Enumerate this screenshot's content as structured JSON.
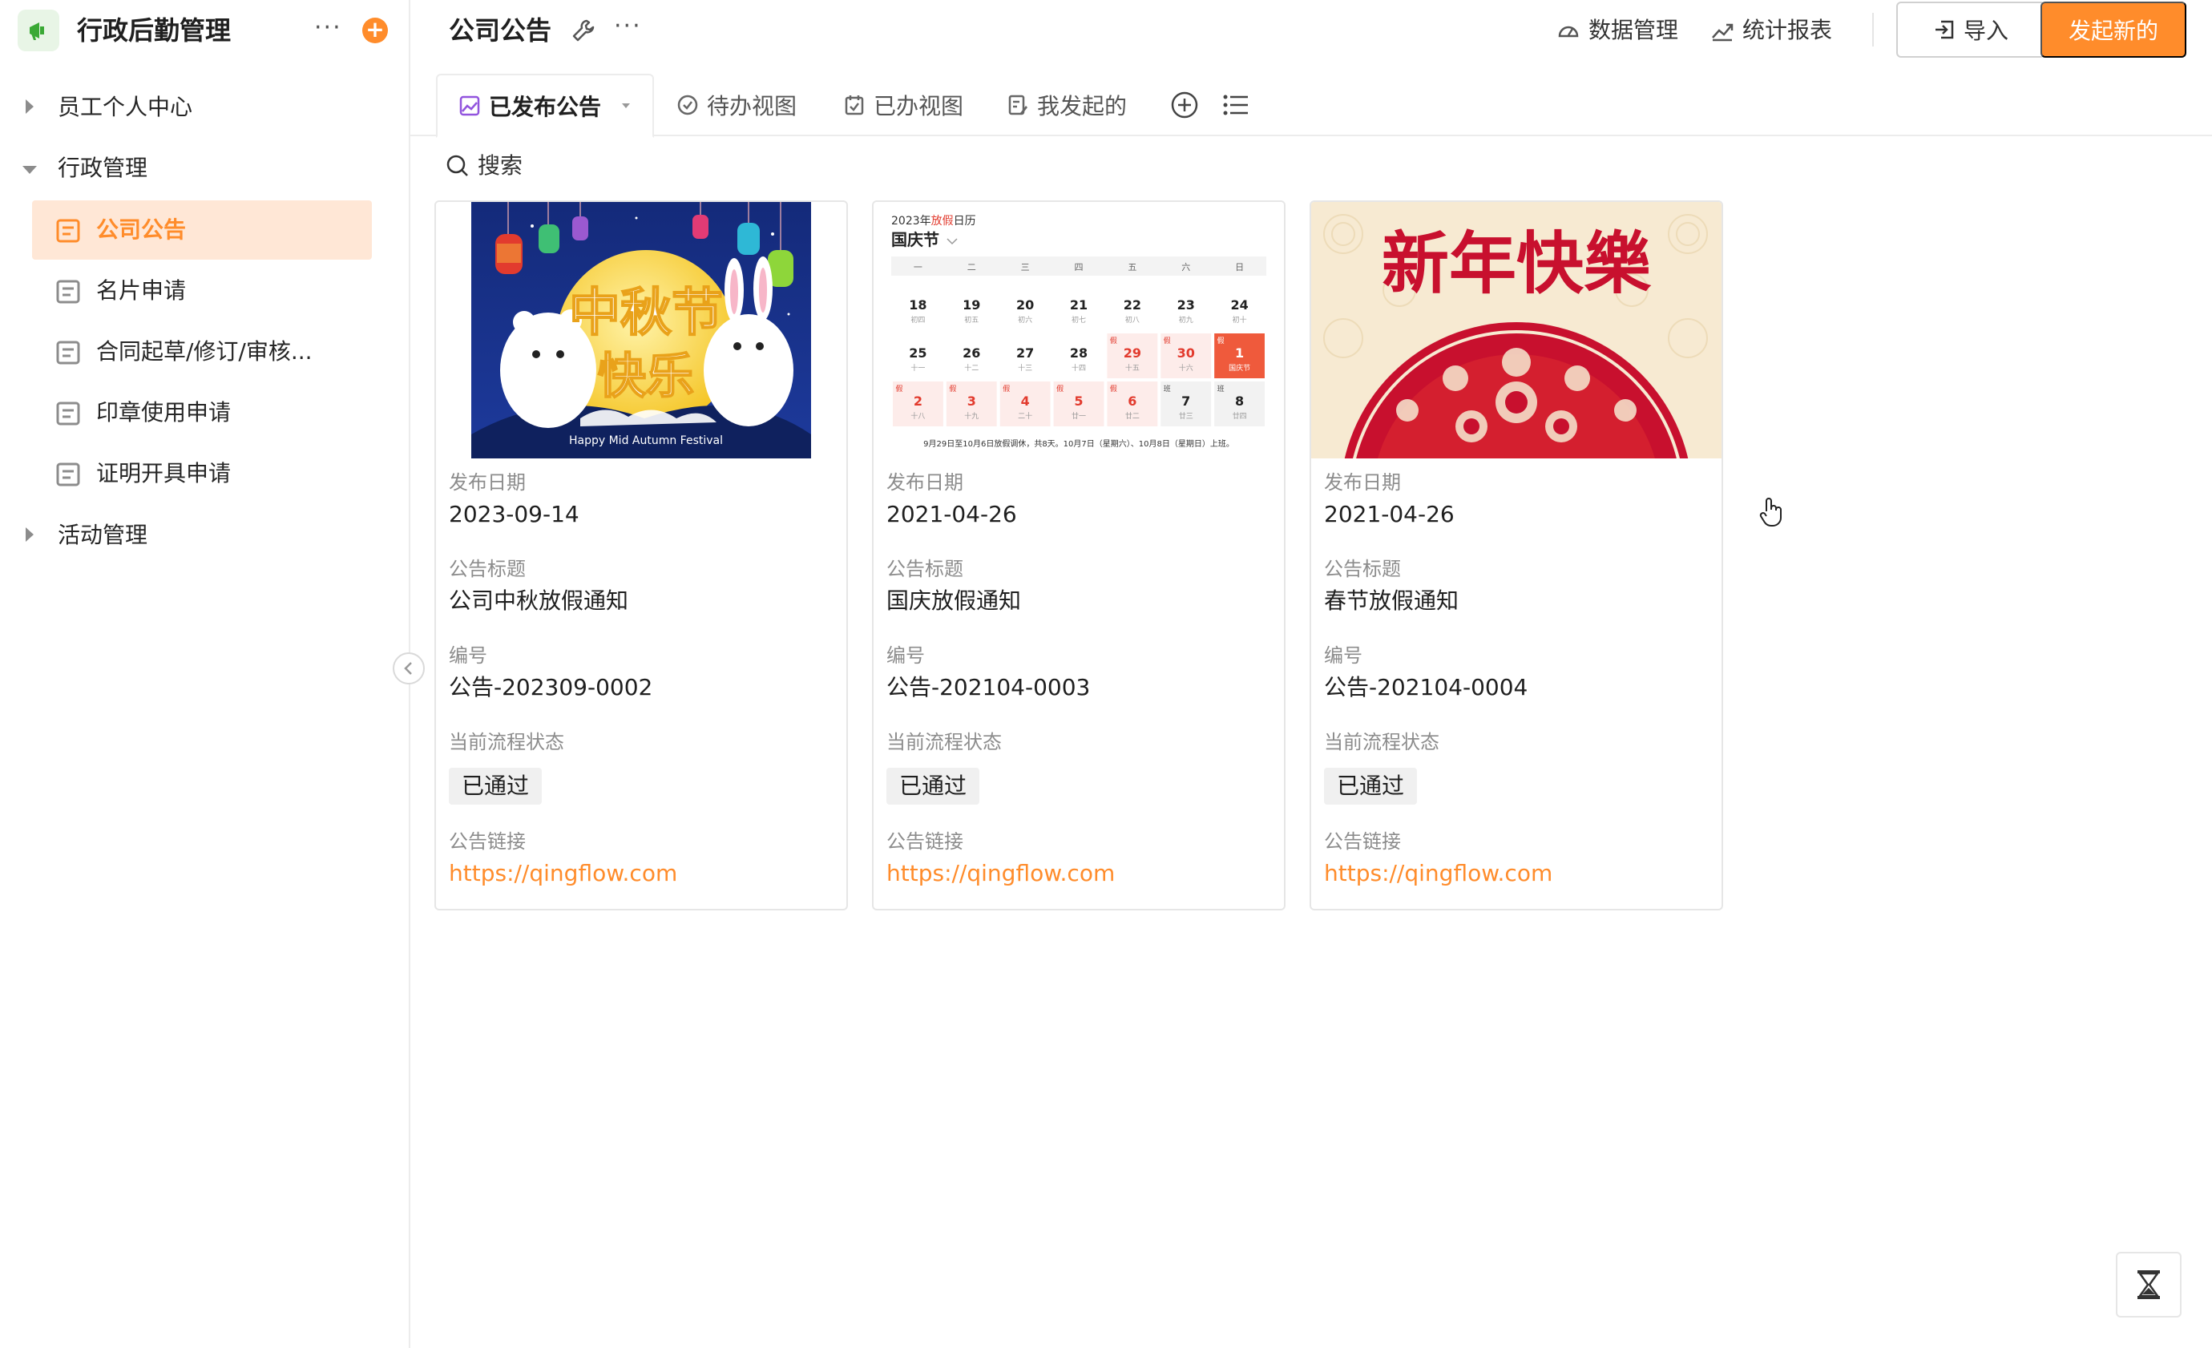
{
  "app": {
    "title": "行政后勤管理",
    "more_label": "···",
    "add_label": "+"
  },
  "sidebar": {
    "groups": [
      {
        "label": "员工个人中心",
        "expanded": false
      },
      {
        "label": "行政管理",
        "expanded": true
      },
      {
        "label": "活动管理",
        "expanded": false
      }
    ],
    "items": [
      {
        "label": "公司公告",
        "active": true
      },
      {
        "label": "名片申请"
      },
      {
        "label": "合同起草/修订/审核..."
      },
      {
        "label": "印章使用申请"
      },
      {
        "label": "证明开具申请"
      }
    ]
  },
  "header": {
    "title": "公司公告",
    "more_label": "···",
    "links": [
      {
        "label": "数据管理"
      },
      {
        "label": "统计报表"
      }
    ],
    "import_label": "导入",
    "new_label": "发起新的"
  },
  "tabs": [
    {
      "label": "已发布公告",
      "active": true
    },
    {
      "label": "待办视图"
    },
    {
      "label": "已办视图"
    },
    {
      "label": "我发起的"
    }
  ],
  "search": {
    "placeholder": "搜索"
  },
  "field_labels": {
    "date": "发布日期",
    "title": "公告标题",
    "number": "编号",
    "status": "当前流程状态",
    "link": "公告链接"
  },
  "cards": [
    {
      "date": "2023-09-14",
      "title": "公司中秋放假通知",
      "number": "公告-202309-0002",
      "status": "已通过",
      "link": "https://qingflow.com",
      "image": {
        "text_main": "中秋节",
        "text_sub": "快乐",
        "caption": "Happy Mid Autumn Festival"
      }
    },
    {
      "date": "2021-04-26",
      "title": "国庆放假通知",
      "number": "公告-202104-0003",
      "status": "已通过",
      "link": "https://qingflow.com",
      "image": {
        "year_prefix": "2023年",
        "year_holiday": "放假",
        "year_suffix": "日历",
        "holiday": "国庆节",
        "weekdays": [
          "一",
          "二",
          "三",
          "四",
          "五",
          "六",
          "日"
        ],
        "note": "9月29日至10月6日放假调休，共8天。10月7日（星期六）、10月8日（星期日）上班。",
        "rows": [
          [
            {
              "n": "18",
              "l": "初四"
            },
            {
              "n": "19",
              "l": "初五"
            },
            {
              "n": "20",
              "l": "初六"
            },
            {
              "n": "21",
              "l": "初七"
            },
            {
              "n": "22",
              "l": "初八"
            },
            {
              "n": "23",
              "l": "初九"
            },
            {
              "n": "24",
              "l": "初十"
            }
          ],
          [
            {
              "n": "25",
              "l": "十一"
            },
            {
              "n": "26",
              "l": "十二"
            },
            {
              "n": "27",
              "l": "十三"
            },
            {
              "n": "28",
              "l": "十四"
            },
            {
              "n": "29",
              "l": "十五",
              "h": "假",
              "t": "off"
            },
            {
              "n": "30",
              "l": "十六",
              "h": "假",
              "t": "off"
            },
            {
              "n": "1",
              "l": "国庆节",
              "h": "假",
              "t": "main"
            }
          ],
          [
            {
              "n": "2",
              "l": "十八",
              "h": "假",
              "t": "off"
            },
            {
              "n": "3",
              "l": "十九",
              "h": "假",
              "t": "off"
            },
            {
              "n": "4",
              "l": "二十",
              "h": "假",
              "t": "off"
            },
            {
              "n": "5",
              "l": "廿一",
              "h": "假",
              "t": "off"
            },
            {
              "n": "6",
              "l": "廿二",
              "h": "假",
              "t": "off"
            },
            {
              "n": "7",
              "l": "廿三",
              "h": "班",
              "t": "work"
            },
            {
              "n": "8",
              "l": "廿四",
              "h": "班",
              "t": "work"
            }
          ]
        ]
      }
    },
    {
      "date": "2021-04-26",
      "title": "春节放假通知",
      "number": "公告-202104-0004",
      "status": "已通过",
      "link": "https://qingflow.com",
      "image": {
        "text_main": "新年快樂"
      }
    }
  ],
  "colors": {
    "accent": "#ff8c2b",
    "active_bg": "#ffe7d6",
    "app_icon": "#3aa935"
  }
}
